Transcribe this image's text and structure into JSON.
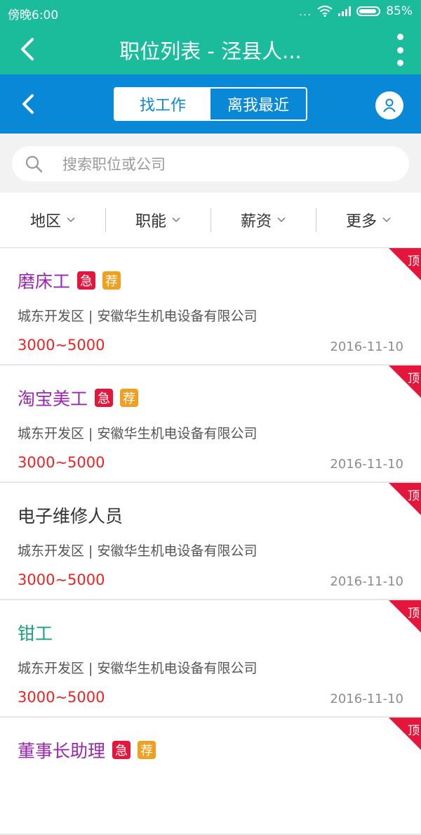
{
  "status_bar": {
    "time": "傍晚6:00",
    "dots": "...",
    "battery": "85%"
  },
  "title_bar": {
    "title": "职位列表 - 泾县人..."
  },
  "toolbar": {
    "tabs": [
      "找工作",
      "离我最近"
    ],
    "active_tab": "找工作"
  },
  "search": {
    "placeholder": "搜索职位或公司",
    "value": ""
  },
  "filters": [
    {
      "label": "地区"
    },
    {
      "label": "职能"
    },
    {
      "label": "薪资"
    },
    {
      "label": "更多"
    }
  ],
  "jobs": [
    {
      "title": "磨床工",
      "title_color": "#9b27b0",
      "urgent": "急",
      "recommend": "荐",
      "company": "城东开发区 | 安徽华生机电设备有限公司",
      "salary": "3000~5000",
      "date": "2016-11-10",
      "badge": "顶"
    },
    {
      "title": "淘宝美工",
      "title_color": "#9b27b0",
      "urgent": "急",
      "recommend": "荐",
      "company": "城东开发区 | 安徽华生机电设备有限公司",
      "salary": "3000~5000",
      "date": "2016-11-10",
      "badge": "顶"
    },
    {
      "title": "电子维修人员",
      "title_color": "#333333",
      "company": "城东开发区 | 安徽华生机电设备有限公司",
      "salary": "3000~5000",
      "date": "2016-11-10",
      "badge": "顶"
    },
    {
      "title": "钳工",
      "title_color": "#1aa37a",
      "company": "城东开发区 | 安徽华生机电设备有限公司",
      "salary": "3000~5000",
      "date": "2016-11-10",
      "badge": "顶"
    },
    {
      "title": "董事长助理",
      "title_color": "#9b27b0",
      "urgent": "急",
      "recommend": "荐",
      "badge": "顶"
    }
  ],
  "colors": {
    "teal": "#1abc9c",
    "blue": "#0a88d8",
    "red": "#ee2222",
    "ribbon": "#e5163c"
  }
}
